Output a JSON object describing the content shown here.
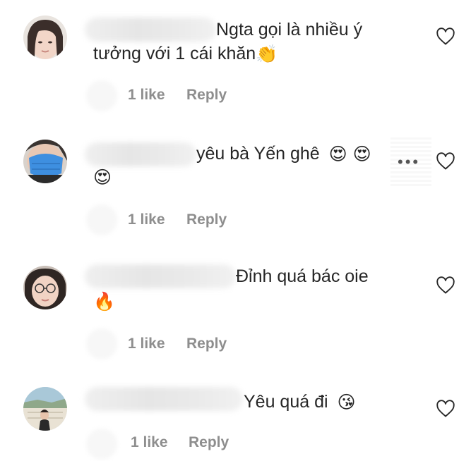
{
  "comments": [
    {
      "line1": "Ngta gọi là nhiều ý",
      "line2": "tưởng với 1 cái khăn",
      "line2_emoji": "👏",
      "likes": "1 like",
      "reply": "Reply"
    },
    {
      "line1": "yêu bà Yến ghê",
      "line1_emoji": "😍 😍",
      "line2_emoji": "😍",
      "more": "•••",
      "likes": "1 like",
      "reply": "Reply"
    },
    {
      "line1": "Đỉnh quá bác oie",
      "line2_emoji": "🔥",
      "likes": "1 like",
      "reply": "Reply"
    },
    {
      "line1": "Yêu quá đi",
      "line1_emoji": "😘",
      "likes": "1 like",
      "reply": "Reply"
    }
  ],
  "icons": {
    "like": "heart-outline-icon",
    "more": "more-options-icon"
  }
}
